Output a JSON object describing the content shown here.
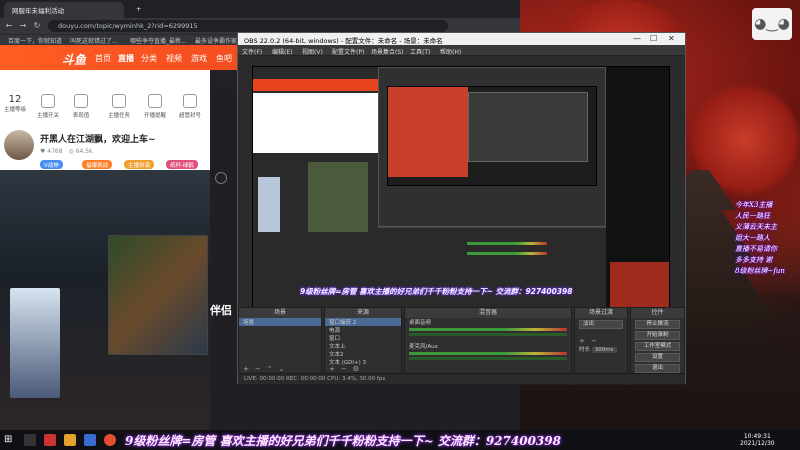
{
  "browser": {
    "tabs": [
      "网服年未福利活动",
      "—"
    ],
    "url": "douyu.com/topic/wyminhk_2?rid=6299915",
    "bookmarks": [
      "百度一下，你就知道",
      "叫死这就错过了...",
      "哪些争夺直播_最新...",
      "最多设争霸作家_..."
    ],
    "nav_links": [
      "首页",
      "直播",
      "分类",
      "视频",
      "游戏",
      "鱼吧"
    ],
    "logo": "斗鱼",
    "room_title": "开黑人在江湖飘，欢迎上车~",
    "subheader_items": [
      "主播等级",
      "主播开关",
      "表现值",
      "主播任务",
      "开播提醒",
      "超管封号"
    ],
    "level_number": "12",
    "chips": [
      "V战神",
      "福爆挑战",
      "主播扮演",
      "纸杯·绿鹤"
    ],
    "follow_count": "4768",
    "watch_count": "64.5k",
    "side_text": "伴侣"
  },
  "obs": {
    "title": "OBS 22.0.2 (64-bit, windows) - 配置文件：未命名 - 场景：未命名",
    "menu": [
      "文件(F)",
      "编辑(E)",
      "视图(V)",
      "配置文件(P)",
      "场景集合(S)",
      "工具(T)",
      "帮助(H)"
    ],
    "docks": {
      "scenes": {
        "title": "场景",
        "items": [
          "场景"
        ]
      },
      "sources": {
        "title": "来源",
        "items": [
          "窗口捕获 2",
          "电源",
          "窗口",
          "文本上",
          "文本2",
          "文本 (GDI+) 3"
        ]
      },
      "mixer": {
        "title": "混音器",
        "channels": [
          "桌面音频",
          "麦克风/Aux"
        ]
      },
      "transitions": {
        "title": "场景过渡",
        "type": "淡出",
        "duration_label": "时长",
        "duration": "300ms"
      },
      "controls": {
        "title": "控件",
        "buttons": [
          "停止推流",
          "开始录制",
          "工作室模式",
          "设置",
          "退出"
        ]
      }
    },
    "status": "LIVE: 00:00:00    REC: 00:00:00    CPU: 3.4%, 30.00 fps"
  },
  "overlay": {
    "right_lines": [
      "今年X3主播",
      "人民一路狂",
      "义薄云天未主",
      "姐大一路人",
      "直播不易请你",
      "多多支持 谢",
      "8级粉丝牌~fun"
    ],
    "banner": "9级粉丝牌=房管 喜欢主播的好兄弟们千千粉粉支持一下~ 交流群：927400398",
    "bottom_banner": "9级粉丝牌=房管 喜欢主播的好兄弟们千千粉粉支持一下~ 交流群：927400398"
  },
  "taskbar": {
    "time": "10:49:31",
    "date": "2021/12/30"
  },
  "colors": {
    "douyu_orange": "#ff5d23",
    "obs_bg": "#2b2b2b",
    "overlay_glow": "#7030ff"
  }
}
